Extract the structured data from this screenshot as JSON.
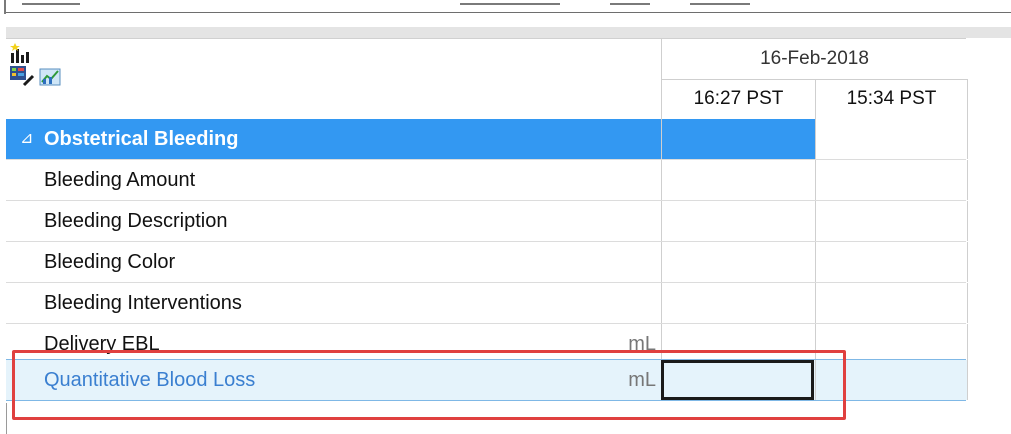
{
  "flowsheet": {
    "header": {
      "date": "16-Feb-2018",
      "times": [
        "16:27 PST",
        "15:34 PST"
      ]
    },
    "section": {
      "toggle_glyph": "⊿",
      "title": "Obstetrical Bleeding"
    },
    "rows": [
      {
        "label": "Bleeding Amount",
        "unit": ""
      },
      {
        "label": "Bleeding Description",
        "unit": ""
      },
      {
        "label": "Bleeding Color",
        "unit": ""
      },
      {
        "label": "Bleeding Interventions",
        "unit": ""
      },
      {
        "label": "Delivery EBL",
        "unit": "mL"
      },
      {
        "label": "Quantitative Blood Loss",
        "unit": "mL"
      }
    ]
  },
  "icons": [
    "chart-sparkle-icon",
    "flowsheet-edit-icon",
    "graph-icon"
  ],
  "colors": {
    "section_bg": "#3398f2",
    "selected_row_bg": "#e5f3fb",
    "selected_label": "#3a7fd0",
    "annotation_box": "#e0403f"
  }
}
